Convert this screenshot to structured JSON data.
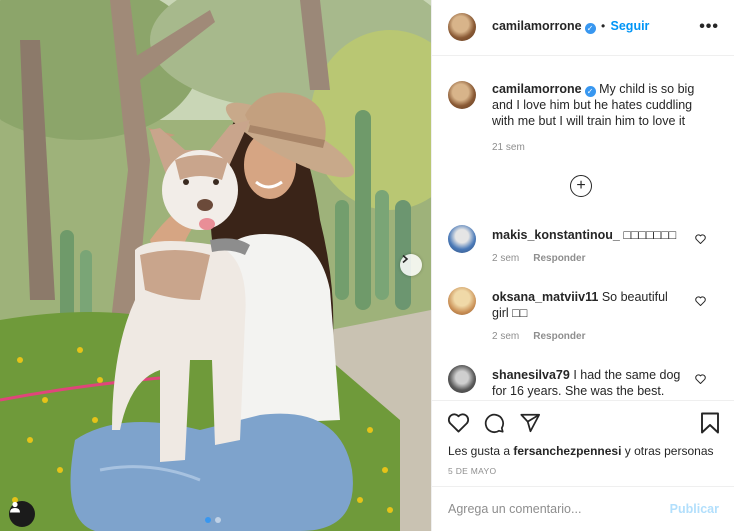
{
  "post": {
    "author": "camilamorrone",
    "follow_label": "Seguir",
    "follow_separator": "•",
    "more_label": "•••",
    "caption": "My child is so big and I love him but he hates cuddling with me but I will train him to love it",
    "caption_time": "21 sem"
  },
  "comments": [
    {
      "user": "makis_konstantinou_",
      "text": "□□□□□□□",
      "time": "2 sem",
      "reply": "Responder"
    },
    {
      "user": "oksana_matviiv11",
      "text": "So beautiful girl □□",
      "time": "2 sem",
      "reply": "Responder"
    },
    {
      "user": "shanesilva79",
      "text": "I had the same dog for 16 years. She was the best.",
      "time": "",
      "reply": ""
    }
  ],
  "likes": {
    "prefix": "Les gusta a",
    "user": "fersanchezpennesi",
    "suffix": "y otras personas"
  },
  "date": "5 DE MAYO",
  "composer": {
    "placeholder": "Agrega un comentario...",
    "publish_label": "Publicar"
  },
  "icons": {
    "more": "more-options-icon",
    "verified": "verified-badge-icon",
    "plus": "load-more-comments-icon",
    "like": "heart-icon",
    "comment": "comment-icon",
    "share": "share-icon",
    "save": "bookmark-icon",
    "next": "chevron-right-icon",
    "tags": "user-tag-icon"
  },
  "colors": {
    "accent": "#0095f6",
    "publish_disabled": "#b2dffc",
    "carousel_active_dot": "#3897f0"
  },
  "carousel": {
    "slides": 2,
    "active": 1
  }
}
